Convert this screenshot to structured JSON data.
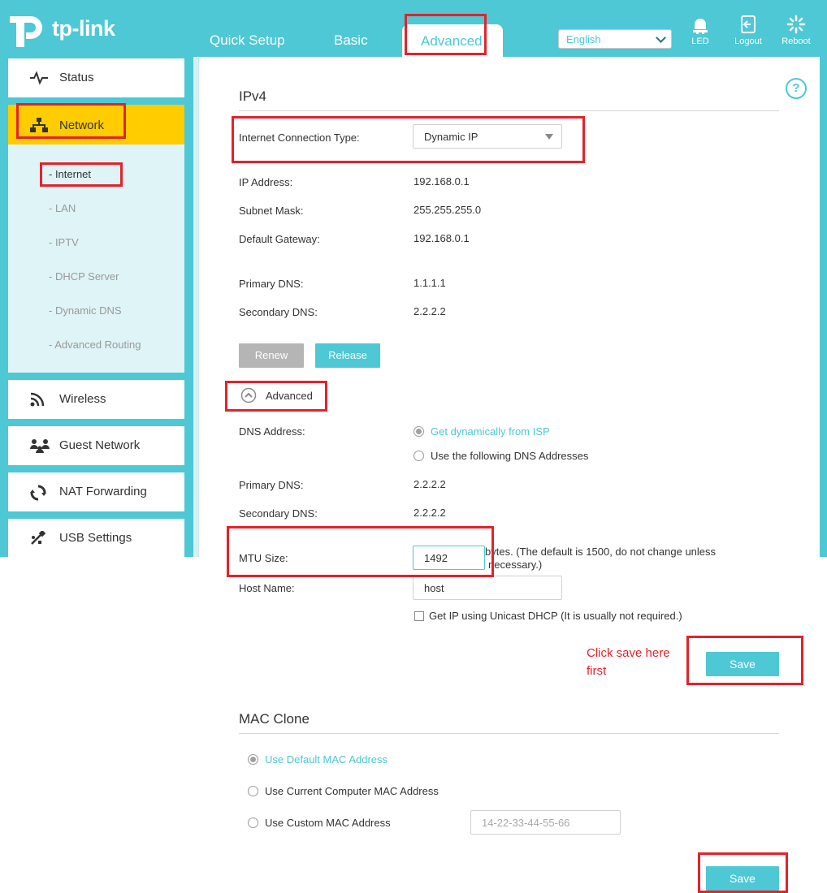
{
  "header": {
    "brand": "tp-link",
    "tabs": [
      "Quick Setup",
      "Basic",
      "Advanced"
    ],
    "language": "English",
    "icons": [
      {
        "name": "led",
        "label": "LED"
      },
      {
        "name": "logout",
        "label": "Logout"
      },
      {
        "name": "reboot",
        "label": "Reboot"
      }
    ]
  },
  "sidebar": {
    "items": [
      {
        "label": "Status",
        "icon": "pulse-icon"
      },
      {
        "label": "Network",
        "icon": "network-icon"
      },
      {
        "label": "Wireless",
        "icon": "wifi-icon"
      },
      {
        "label": "Guest Network",
        "icon": "guest-network-icon"
      },
      {
        "label": "NAT Forwarding",
        "icon": "nat-icon"
      },
      {
        "label": "USB Settings",
        "icon": "usb-icon"
      }
    ],
    "subitems": [
      "- Internet",
      "- LAN",
      "- IPTV",
      "- DHCP Server",
      "- Dynamic DNS",
      "- Advanced Routing"
    ]
  },
  "ipv4": {
    "title": "IPv4",
    "connection_type_label": "Internet Connection Type:",
    "connection_type_value": "Dynamic IP",
    "ip_label": "IP Address:",
    "ip_value": "192.168.0.1",
    "subnet_label": "Subnet Mask:",
    "subnet_value": "255.255.255.0",
    "gateway_label": "Default Gateway:",
    "gateway_value": "192.168.0.1",
    "primary_dns_label": "Primary DNS:",
    "primary_dns_value": "1.1.1.1",
    "secondary_dns_label": "Secondary DNS:",
    "secondary_dns_value": "2.2.2.2",
    "renew_label": "Renew",
    "release_label": "Release"
  },
  "advanced": {
    "toggle_label": "Advanced",
    "dns_address_label": "DNS Address:",
    "dns_option_isp": "Get dynamically from ISP",
    "dns_option_manual": "Use the following DNS Addresses",
    "primary_dns_label": "Primary DNS:",
    "primary_dns_value": "2.2.2.2",
    "secondary_dns_label": "Secondary DNS:",
    "secondary_dns_value": "2.2.2.2",
    "mtu_label": "MTU Size:",
    "mtu_value": "1492",
    "mtu_note_line1": "bytes. (The default is 1500, do not change unless",
    "mtu_note_line2": "necessary.)",
    "host_label": "Host Name:",
    "host_value": "host",
    "unicast_label": "Get IP using Unicast DHCP (It is usually not required.)",
    "save_label": "Save"
  },
  "annotation": {
    "line1": "Click save here",
    "line2": "first"
  },
  "mac_clone": {
    "title": "MAC Clone",
    "option_default": "Use Default MAC Address",
    "option_current": "Use Current Computer MAC Address",
    "option_custom": "Use Custom MAC Address",
    "custom_placeholder": "14-22-33-44-55-66",
    "save_label": "Save"
  },
  "colors": {
    "brand": "#4dc8d4",
    "nav_active": "#ffcc00",
    "highlight": "#e4222b"
  }
}
